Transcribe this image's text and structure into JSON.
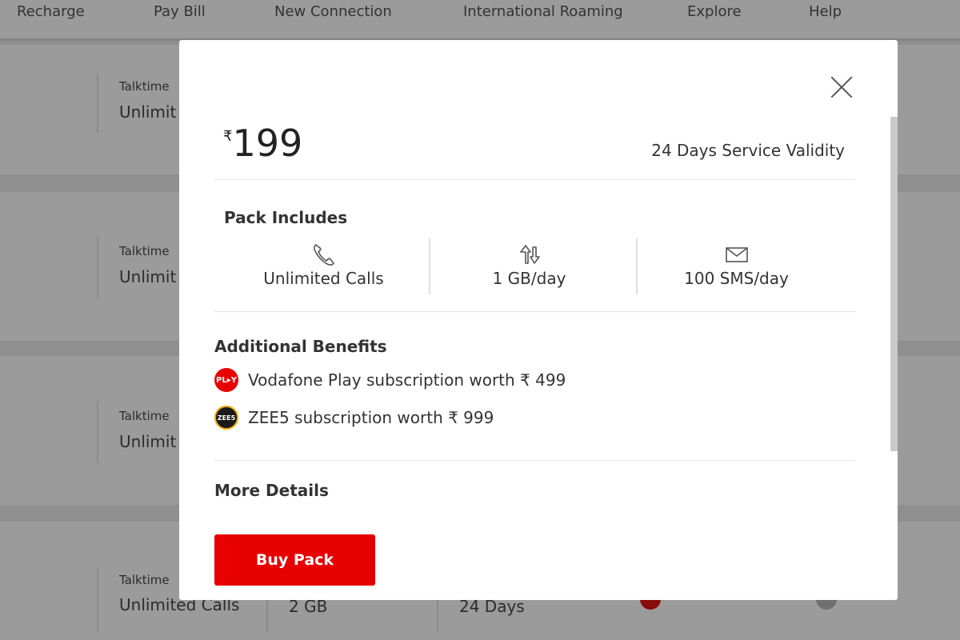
{
  "nav": {
    "items": [
      "Recharge",
      "Pay Bill",
      "New Connection",
      "International Roaming",
      "Explore",
      "Help"
    ]
  },
  "background_cards": {
    "talktime_label": "Talktime",
    "talktime_value": "Unlimit",
    "last_card": {
      "talktime_value": "Unlimited Calls",
      "data_value": "2 GB",
      "validity_value": "24 Days"
    }
  },
  "modal": {
    "price_currency": "₹",
    "price_amount": "199",
    "validity": "24 Days Service Validity",
    "pack_includes_title": "Pack Includes",
    "includes": [
      {
        "icon": "phone-icon",
        "label": "Unlimited Calls"
      },
      {
        "icon": "data-arrows-icon",
        "label": "1 GB/day"
      },
      {
        "icon": "envelope-icon",
        "label": "100 SMS/day"
      }
    ],
    "additional_benefits_title": "Additional Benefits",
    "benefits": [
      {
        "icon": "vodafone-play-logo-icon",
        "logo_text": "PL▸Y",
        "label": "Vodafone Play subscription worth ₹ 499"
      },
      {
        "icon": "zee5-logo-icon",
        "logo_text": "ZEE5",
        "label": "ZEE5 subscription worth ₹ 999"
      }
    ],
    "more_details_title": "More Details",
    "buy_button": "Buy Pack"
  },
  "colors": {
    "accent": "#e60000",
    "overlay": "#9b9b9b"
  }
}
